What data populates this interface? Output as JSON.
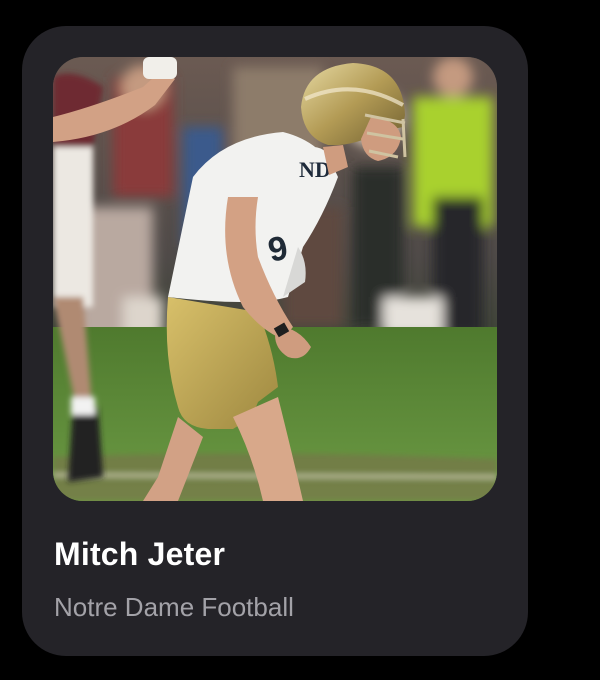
{
  "card": {
    "name": "Mitch Jeter",
    "subtitle": "Notre Dame Football"
  },
  "photo": {
    "subject": "football-player-photo",
    "jersey_logo": "ND"
  },
  "colors": {
    "page_background": "#000000",
    "card_background": "#242328",
    "name_color": "#ffffff",
    "subtitle_color": "#a3a2a8",
    "helmet_gold": "#b9a464",
    "pants_gold": "#c6ad55",
    "field_green": "#5c8a3c"
  }
}
